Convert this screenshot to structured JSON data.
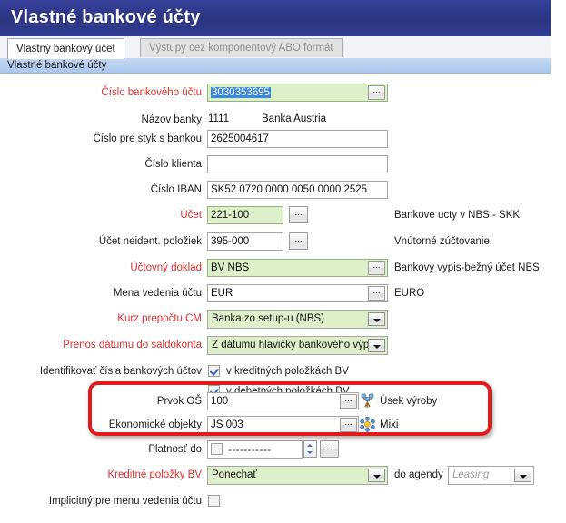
{
  "window": {
    "title": "Vlastné bankové účty"
  },
  "tabs": [
    {
      "label": "Vlastný bankový účet",
      "active": true
    },
    {
      "label": "Výstupy cez komponentový ABO formát",
      "active": false
    }
  ],
  "group_header": {
    "label": "Vlastné bankové účty"
  },
  "colors": {
    "title_bar": "#2e3d8f",
    "required_label": "#e03030",
    "mandatory_field_bg": "#ddf0c9",
    "selection_bg": "#3a87de",
    "annotation_box": "#e01b1b",
    "group_header_bg": "#aac6ec"
  },
  "form": {
    "account_number": {
      "label": "Číslo bankového účtu",
      "value": "3030353695",
      "selected": true,
      "required": true,
      "button": "..."
    },
    "bank_name": {
      "label": "Názov banky",
      "code": "1111",
      "name": "Banka Austria"
    },
    "bank_contact_number": {
      "label": "Číslo pre styk s bankou",
      "value": "2625004617"
    },
    "client_number": {
      "label": "Číslo klienta",
      "value": ""
    },
    "iban": {
      "label": "Číslo IBAN",
      "value": "SK52 0720 0000 0050 0000 2525"
    },
    "account": {
      "label": "Účet",
      "value": "221-100",
      "required": true,
      "button": "...",
      "description": "Bankove ucty v NBS - SKK"
    },
    "unidentified_items_account": {
      "label": "Účet neident. položiek",
      "value": "395-000",
      "button": "...",
      "description": "Vnútorné zúčtovanie"
    },
    "accounting_document": {
      "label": "Účtovný doklad",
      "value": "BV  NBS",
      "required": true,
      "button": "...",
      "description": "Bankovy vypis-bežný účet NBS"
    },
    "account_currency": {
      "label": "Mena vedenia účtu",
      "value": "EUR",
      "button": "...",
      "description": "EURO"
    },
    "exchange_rate": {
      "label": "Kurz prepočtu CM",
      "value": "Banka zo setup-u (NBS)",
      "required": true
    },
    "date_transfer": {
      "label": "Prenos dátumu do saldokonta",
      "value": "Z dátumu hlavičky bankového výpis",
      "required": true
    },
    "identify_accounts": {
      "label": "Identifikovať čísla bankových účtov",
      "credit": {
        "label": "v kreditných položkách BV",
        "checked": true
      },
      "debit": {
        "label": "v debetných položkách BV",
        "checked": true
      }
    },
    "org_element": {
      "label": "Prvok OŠ",
      "value": "100",
      "button": "...",
      "icon": "tree-icon",
      "description": "Úsek výroby"
    },
    "economic_objects": {
      "label": "Ekonomické objekty",
      "value": "JS 003",
      "button": "...",
      "icon": "cluster-icon",
      "description": "Mixi"
    },
    "valid_until": {
      "label": "Platnosť do",
      "checked": false,
      "value": "-----------",
      "button": "..."
    },
    "credit_items": {
      "label": "Kreditné položky BV",
      "value": "Ponechať",
      "required": true,
      "agenda_label": "do agendy",
      "agenda_value": "Leasing",
      "agenda_disabled": true
    },
    "implicit_default": {
      "label": "Implicitný pre menu vedenia účtu",
      "checked": false
    }
  }
}
